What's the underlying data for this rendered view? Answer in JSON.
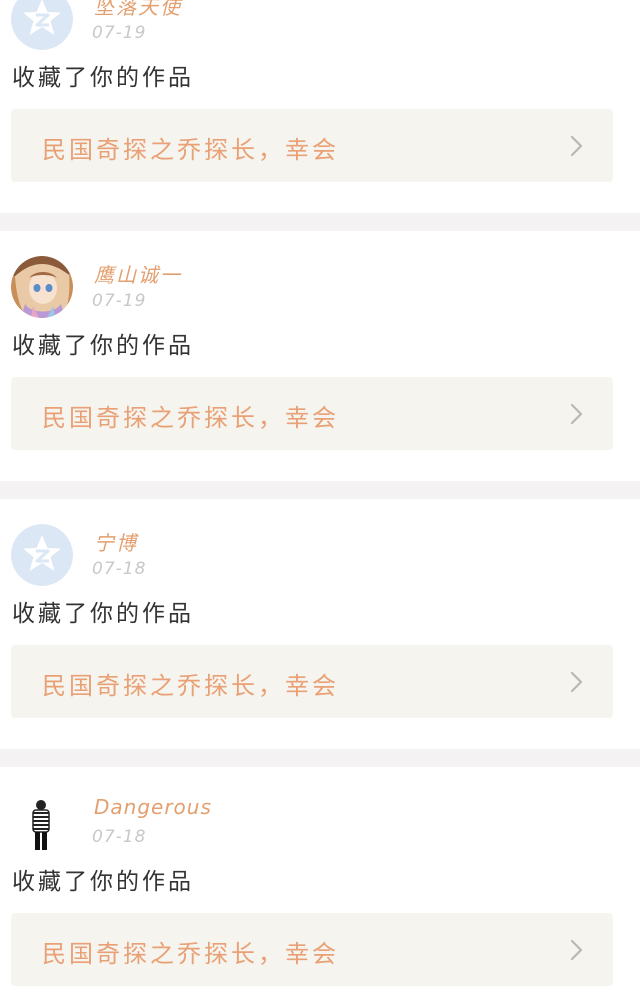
{
  "feed": [
    {
      "username": "坠落天使",
      "date": "07-19",
      "action": "收藏了你的作品",
      "work_title": "民国奇探之乔探长，幸会",
      "avatar": "default-star-avatar"
    },
    {
      "username": "鹰山诚一",
      "date": "07-19",
      "action": "收藏了你的作品",
      "work_title": "民国奇探之乔探长，幸会",
      "avatar": "anime-girl-avatar"
    },
    {
      "username": "宁博",
      "date": "07-18",
      "action": "收藏了你的作品",
      "work_title": "民国奇探之乔探长，幸会",
      "avatar": "default-star-avatar"
    },
    {
      "username": "Dangerous",
      "date": "07-18",
      "action": "收藏了你的作品",
      "work_title": "民国奇探之乔探长，幸会",
      "avatar": "striped-figure-avatar"
    }
  ],
  "colors": {
    "username": "#e39f6f",
    "work_title": "#e9a074",
    "date": "#c8c8c8",
    "card_bg": "#f5f4ef",
    "separator": "#f4f2f2",
    "default_avatar": "#dbe7f5"
  },
  "icons": {
    "chevron": "chevron-right-icon",
    "default_avatar": "star-icon"
  }
}
